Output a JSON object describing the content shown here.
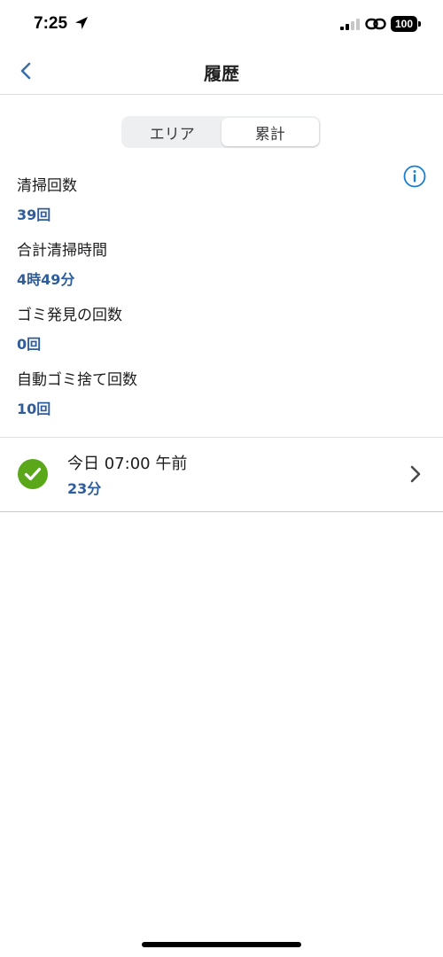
{
  "status_bar": {
    "time": "7:25",
    "battery": "100"
  },
  "nav": {
    "title": "履歴"
  },
  "segments": [
    {
      "label": "エリア",
      "selected": false
    },
    {
      "label": "累計",
      "selected": true
    }
  ],
  "stats": [
    {
      "label": "清掃回数",
      "value": "39回"
    },
    {
      "label": "合計清掃時間",
      "value": "4時49分"
    },
    {
      "label": "ゴミ発見の回数",
      "value": "0回"
    },
    {
      "label": "自動ゴミ捨て回数",
      "value": "10回"
    }
  ],
  "history": [
    {
      "title": "今日 07:00 午前",
      "duration": "23分",
      "status_icon": "check-circle-icon"
    }
  ],
  "colors": {
    "accent_text": "#2f5d9c",
    "info_icon": "#1a7fd4",
    "success": "#5aa81a",
    "divider": "#e2e2e2"
  }
}
